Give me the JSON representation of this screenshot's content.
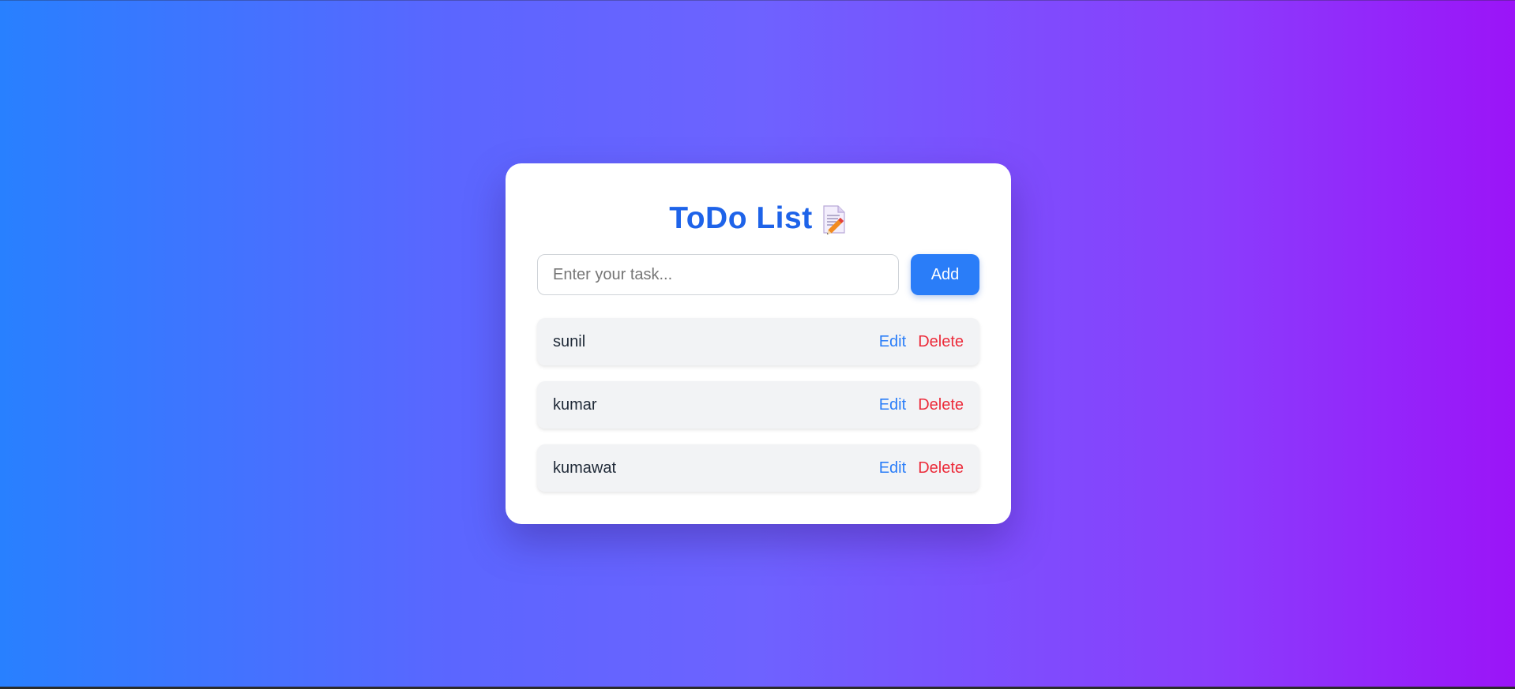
{
  "app": {
    "title": "ToDo List",
    "title_icon": "memo-icon"
  },
  "input": {
    "value": "",
    "placeholder": "Enter your task..."
  },
  "add_button": {
    "label": "Add"
  },
  "actions": {
    "edit_label": "Edit",
    "delete_label": "Delete"
  },
  "tasks": [
    {
      "text": "sunil"
    },
    {
      "text": "kumar"
    },
    {
      "text": "kumawat"
    }
  ],
  "colors": {
    "title": "#1e63e9",
    "primary": "#2a7df8",
    "danger": "#ec2b3a",
    "item_bg": "#f2f3f5",
    "bg_start": "#2880ff",
    "bg_end": "#9b14f8"
  }
}
